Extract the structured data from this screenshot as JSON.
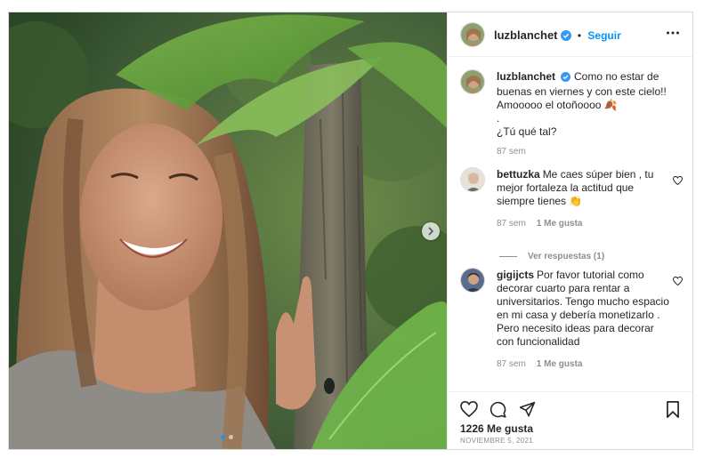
{
  "header": {
    "username": "luzblanchet",
    "separator": "•",
    "follow_label": "Seguir",
    "more_icon": "more-options-icon"
  },
  "caption": {
    "username": "luzblanchet",
    "text_line1": "Como no estar de buenas en viernes y con este cielo!! Amooooo el otoñoooo 🍂",
    "text_line2": ".",
    "text_line3": "¿Tú qué tal?",
    "time": "87 sem"
  },
  "comments": [
    {
      "username": "bettuzka",
      "text": "Me caes súper bien , tu mejor fortaleza la actitud que siempre tienes 👏",
      "time": "87 sem",
      "likes": "1 Me gusta"
    },
    {
      "username": "gigijcts",
      "text": "Por favor tutorial como decorar cuarto para rentar a universitarios. Tengo mucho espacio en mi casa y debería monetizarlo . Pero necesito ideas para decorar con funcionalidad",
      "time": "87 sem",
      "likes": "1 Me gusta"
    }
  ],
  "replies_label": "Ver respuestas (1)",
  "actions": {
    "likes": "1226 Me gusta",
    "date": "NOVIEMBRE 5, 2021"
  },
  "colors": {
    "accent": "#0095f6",
    "verified": "#3897f0",
    "muted": "#8e8e8e"
  },
  "carousel": {
    "current": 1,
    "total": 2
  }
}
